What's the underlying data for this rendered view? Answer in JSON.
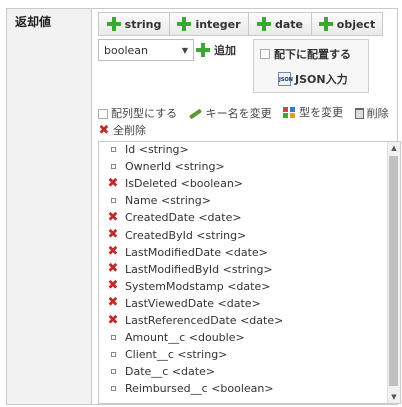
{
  "field_label": "返却値",
  "type_buttons": {
    "string": "string",
    "integer": "integer",
    "date": "date",
    "object": "object"
  },
  "type_select": {
    "value": "boolean"
  },
  "add_label": "追加",
  "place_under_label": "配下に配置する",
  "json_input_label": "JSON入力",
  "json_icon_text": "JSON",
  "toolbar": {
    "array_type_label": "配列型にする",
    "rename_label": "キー名を変更",
    "change_type_label": "型を変更",
    "delete_label": "削除",
    "delete_all_label": "全削除"
  },
  "fields": [
    {
      "text": "Id <string>",
      "icon": "square"
    },
    {
      "text": "OwnerId <string>",
      "icon": "square"
    },
    {
      "text": "IsDeleted <boolean>",
      "icon": "x"
    },
    {
      "text": "Name <string>",
      "icon": "square"
    },
    {
      "text": "CreatedDate <date>",
      "icon": "x"
    },
    {
      "text": "CreatedById <string>",
      "icon": "x"
    },
    {
      "text": "LastModifiedDate <date>",
      "icon": "x"
    },
    {
      "text": "LastModifiedById <string>",
      "icon": "x"
    },
    {
      "text": "SystemModstamp <date>",
      "icon": "x"
    },
    {
      "text": "LastViewedDate <date>",
      "icon": "x"
    },
    {
      "text": "LastReferencedDate <date>",
      "icon": "x"
    },
    {
      "text": "Amount__c <double>",
      "icon": "square"
    },
    {
      "text": "Client__c <string>",
      "icon": "square"
    },
    {
      "text": "Date__c <date>",
      "icon": "square"
    },
    {
      "text": "Reimbursed__c <boolean>",
      "icon": "square"
    }
  ],
  "colors": {
    "add_green": "#3aa832",
    "delete_red": "#c62828"
  }
}
